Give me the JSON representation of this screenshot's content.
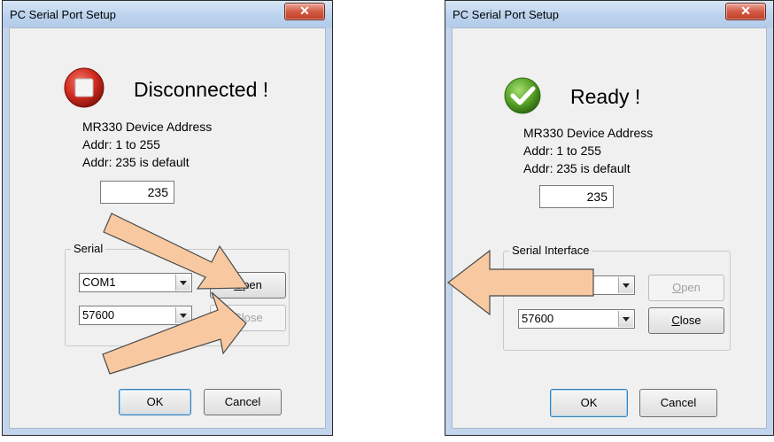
{
  "left_dialog": {
    "title": "PC Serial Port Setup",
    "close_glyph": "✕",
    "status_text": "Disconnected !",
    "status_icon": "stop-icon",
    "info_lines": [
      "MR330 Device Address",
      "Addr: 1 to 255",
      "Addr: 235 is default"
    ],
    "address_value": "235",
    "group_label": "Serial Interface",
    "group_label_visible": "Serial",
    "port_value": "COM1",
    "baud_value": "57600",
    "open_label": "Open",
    "open_enabled": true,
    "close_label": "Close",
    "close_enabled": false,
    "ok_label": "OK",
    "cancel_label": "Cancel"
  },
  "right_dialog": {
    "title": "PC Serial Port Setup",
    "close_glyph": "✕",
    "status_text": "Ready !",
    "status_icon": "check-icon",
    "info_lines": [
      "MR330 Device Address",
      "Addr: 1 to 255",
      "Addr: 235 is default"
    ],
    "address_value": "235",
    "group_label": "Serial Interface",
    "port_value": "",
    "baud_value": "57600",
    "open_label": "Open",
    "open_enabled": false,
    "close_label": "Close",
    "close_enabled": true,
    "ok_label": "OK",
    "cancel_label": "Cancel"
  },
  "colors": {
    "arrow_fill": "#f8c9a0",
    "arrow_stroke": "#4a4a4a",
    "stop_red": "#d32b1f",
    "check_green": "#5aa52a"
  }
}
